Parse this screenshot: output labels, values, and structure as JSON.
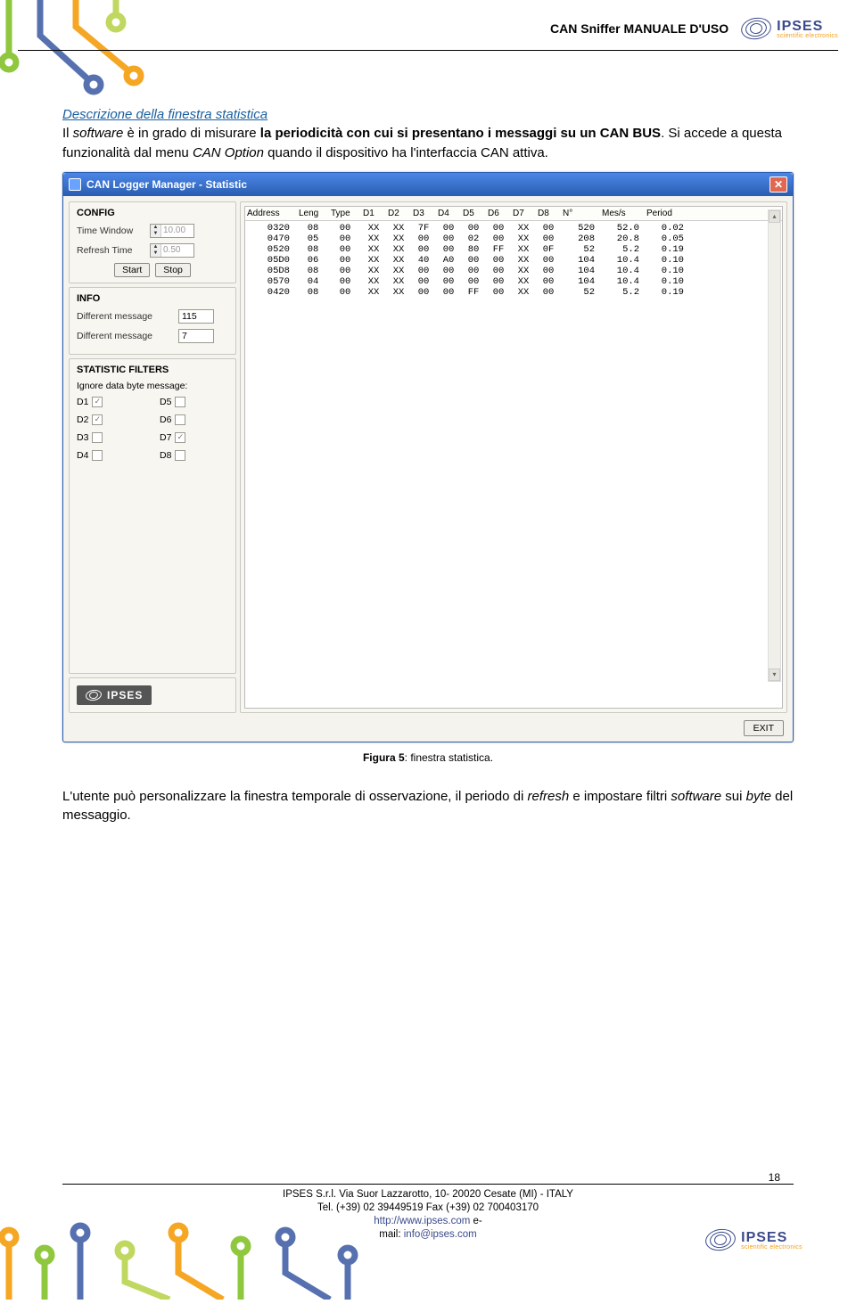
{
  "header": {
    "doc_title": "CAN Sniffer MANUALE D'USO",
    "logo_name": "IPSES",
    "logo_sub": "scientific electronics"
  },
  "section": {
    "title": "Descrizione della finestra statistica",
    "paragraph1_a": "Il ",
    "paragraph1_b": "software",
    "paragraph1_c": " è in grado di misurare ",
    "paragraph1_d": "la periodicità con cui si presentano i messaggi su un CAN BUS",
    "paragraph1_e": ". Si accede a questa funzionalità dal menu ",
    "paragraph1_f": "CAN Option",
    "paragraph1_g": " quando il dispositivo ha l'interfaccia CAN attiva.",
    "caption_b": "Figura 5",
    "caption_r": ": finestra statistica.",
    "paragraph2_a": "L'utente può personalizzare la finestra temporale di osservazione, il periodo di ",
    "paragraph2_b": "refresh",
    "paragraph2_c": " e impostare filtri ",
    "paragraph2_d": "software",
    "paragraph2_e": " sui ",
    "paragraph2_f": "byte",
    "paragraph2_g": " del messaggio."
  },
  "app": {
    "title": "CAN Logger Manager  -  Statistic",
    "close_glyph": "✕",
    "config": {
      "title": "CONFIG",
      "time_window_label": "Time Window",
      "time_window_value": "10.00",
      "refresh_label": "Refresh Time",
      "refresh_value": "0.50",
      "start_label": "Start",
      "stop_label": "Stop"
    },
    "info": {
      "title": "INFO",
      "diff_msg_label1": "Different message",
      "diff_msg_value1": "115",
      "diff_msg_label2": "Different message",
      "diff_msg_value2": "7"
    },
    "filters": {
      "title": "STATISTIC FILTERS",
      "sub": "Ignore data byte message:",
      "items": [
        {
          "label": "D1",
          "checked": true
        },
        {
          "label": "D5",
          "checked": false
        },
        {
          "label": "D2",
          "checked": true
        },
        {
          "label": "D6",
          "checked": false
        },
        {
          "label": "D3",
          "checked": false
        },
        {
          "label": "D7",
          "checked": true
        },
        {
          "label": "D4",
          "checked": false
        },
        {
          "label": "D8",
          "checked": false
        }
      ]
    },
    "badge_text": "IPSES",
    "table": {
      "headers": [
        "Address",
        "Leng",
        "Type",
        "D1",
        "D2",
        "D3",
        "D4",
        "D5",
        "D6",
        "D7",
        "D8",
        "N°",
        "Mes/s",
        "Period"
      ],
      "rows": [
        [
          "0320",
          "08",
          "00",
          "XX",
          "XX",
          "7F",
          "00",
          "00",
          "00",
          "XX",
          "00",
          "520",
          "52.0",
          "0.02"
        ],
        [
          "0470",
          "05",
          "00",
          "XX",
          "XX",
          "00",
          "00",
          "02",
          "00",
          "XX",
          "00",
          "208",
          "20.8",
          "0.05"
        ],
        [
          "0520",
          "08",
          "00",
          "XX",
          "XX",
          "00",
          "00",
          "80",
          "FF",
          "XX",
          "0F",
          "52",
          "5.2",
          "0.19"
        ],
        [
          "05D0",
          "06",
          "00",
          "XX",
          "XX",
          "40",
          "A0",
          "00",
          "00",
          "XX",
          "00",
          "104",
          "10.4",
          "0.10"
        ],
        [
          "05D8",
          "08",
          "00",
          "XX",
          "XX",
          "00",
          "00",
          "00",
          "00",
          "XX",
          "00",
          "104",
          "10.4",
          "0.10"
        ],
        [
          "0570",
          "04",
          "00",
          "XX",
          "XX",
          "00",
          "00",
          "00",
          "00",
          "XX",
          "00",
          "104",
          "10.4",
          "0.10"
        ],
        [
          "0420",
          "08",
          "00",
          "XX",
          "XX",
          "00",
          "00",
          "FF",
          "00",
          "XX",
          "00",
          "52",
          "5.2",
          "0.19"
        ]
      ]
    },
    "exit_label": "EXIT"
  },
  "footer": {
    "line1": "IPSES S.r.l.  Via Suor Lazzarotto, 10- 20020 Cesate (MI) - ITALY",
    "line2": "Tel. (+39) 02 39449519   Fax (+39) 02 700403170",
    "line3a": "http://www.ipses.com",
    "line3b": "   e-",
    "line4a": "mail: ",
    "line4b": "info@ipses.com",
    "page": "18"
  }
}
